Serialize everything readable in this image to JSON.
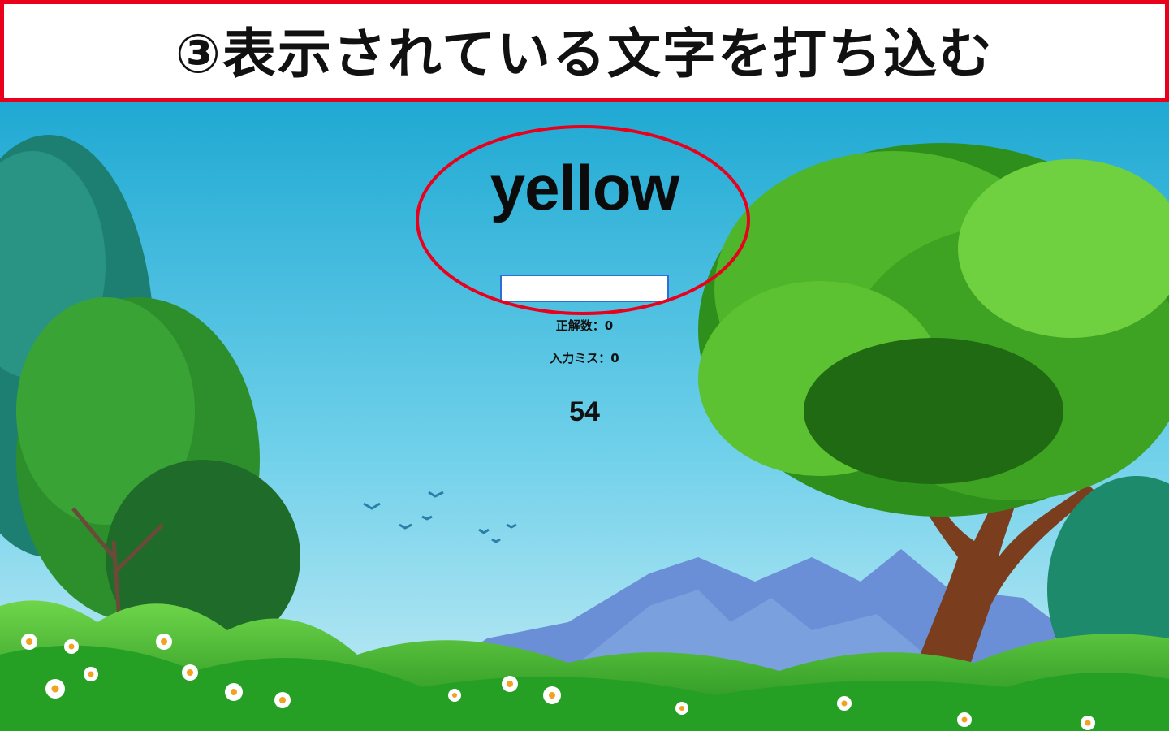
{
  "banner": {
    "text": "③表示されている文字を打ち込む"
  },
  "game": {
    "target_word": "yellow",
    "input_value": "",
    "correct_label": "正解数：0",
    "miss_label": "入力ミス：0",
    "timer": "54"
  },
  "colors": {
    "annotation_red": "#e8001c",
    "sky_top": "#1fa9d3",
    "sky_bottom": "#bfe9f3",
    "grass": "#3bb52c",
    "tree_foliage": "#4fb52a",
    "trunk": "#7a3e1e",
    "mountain": "#6a8fd6"
  }
}
